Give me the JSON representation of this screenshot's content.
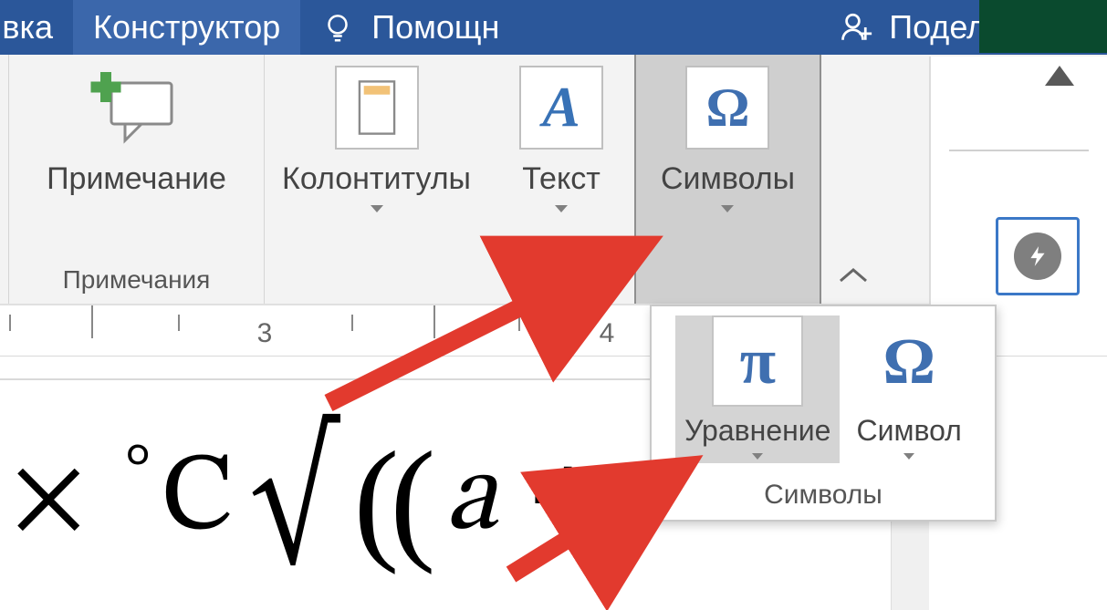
{
  "tabs": {
    "partial_left": "вка",
    "constructor": "Конструктор",
    "help": "Помощн",
    "share": "Поделиться"
  },
  "ribbon": {
    "comment_btn": "Примечание",
    "comments_group": "Примечания",
    "headers_btn": "Колонтитулы",
    "text_btn": "Текст",
    "symbols_btn": "Символы"
  },
  "ruler": {
    "n3": "3",
    "n4": "4"
  },
  "panel": {
    "equation_btn": "Уравнение",
    "symbol_btn": "Символ",
    "group_label": "Символы"
  },
  "equation": {
    "times": "×",
    "deg": "°",
    "c": "C",
    "sqrt": "√",
    "p1": "(",
    "p2": "(",
    "a": "a",
    "plus": "+"
  },
  "icons": {
    "omega": "Ω",
    "pi": "π",
    "omega2": "Ω",
    "A": "А"
  }
}
